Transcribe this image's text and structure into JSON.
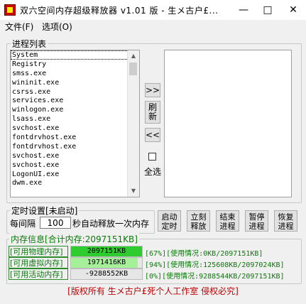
{
  "window": {
    "title": "双六空间内存超级释放器 v1.01 版 - 生メ古户£...",
    "minimize": "—",
    "maximize": "□",
    "close": "✕"
  },
  "menu": {
    "file": "文件(F)",
    "options": "选项(O)"
  },
  "process_list": {
    "label": "进程列表",
    "items": [
      "System",
      "Registry",
      "smss.exe",
      "wininit.exe",
      "csrss.exe",
      "services.exe",
      "winlogon.exe",
      "lsass.exe",
      "svchost.exe",
      "fontdrvhost.exe",
      "fontdrvhost.exe",
      "svchost.exe",
      "svchost.exe",
      "LogonUI.exe",
      "dwm.exe"
    ]
  },
  "middle_buttons": {
    "add": ">>",
    "refresh": "刷新",
    "remove": "<<",
    "select_all": "全选"
  },
  "timer": {
    "label": "定时设置[未启动]",
    "prefix": "每间隔",
    "interval": "100",
    "suffix": "秒自动释放一次内存"
  },
  "actions": {
    "auto": "启动定时",
    "release": "立刻释放",
    "end": "结束进程",
    "pause": "暂停进程",
    "resume": "恢复进程"
  },
  "memory": {
    "label": "内存信息[合计内存:2097151KB]",
    "rows": [
      {
        "label": "[可用物理内存]",
        "value": "2097151KB",
        "percent": 1.0,
        "color": "#2ecc2e",
        "info": "[67%][使用情况:0KB/2097151KB]"
      },
      {
        "label": "[可用虚拟内存]",
        "value": "1971416KB",
        "percent": 0.94,
        "color": "#a6f09a",
        "info": "[94%][使用情况:125608KB/2097024KB]"
      },
      {
        "label": "[可用活动内存]",
        "value": "-9288552KB",
        "percent": 0,
        "color": "#2ecc2e",
        "info": "[0%][使用情况:9288544KB/2097151KB]"
      }
    ]
  },
  "footer": "[版权所有 生メ古户£死个人工作室 侵权必究]"
}
